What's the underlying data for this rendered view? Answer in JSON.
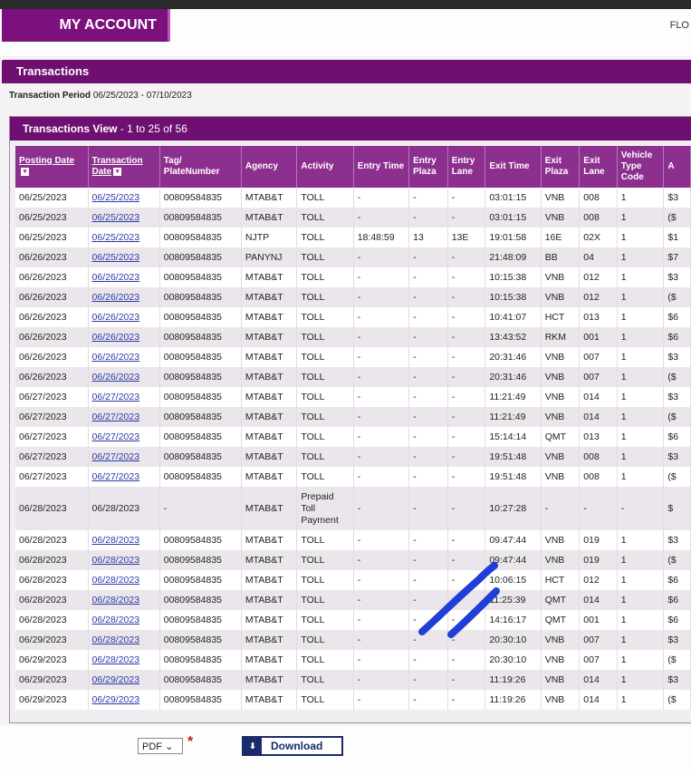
{
  "header": {
    "tab_label": "MY ACCOUNT",
    "right_text": "FLO"
  },
  "section": {
    "title": "Transactions"
  },
  "period": {
    "label": "Transaction Period",
    "value": "06/25/2023 - 07/10/2023"
  },
  "panel": {
    "title": "Transactions View",
    "range": " - 1 to 25 of 56"
  },
  "table": {
    "headers": [
      "Posting Date",
      "Transaction Date",
      "Tag/ PlateNumber",
      "Agency",
      "Activity",
      "Entry Time",
      "Entry Plaza",
      "Entry Lane",
      "Exit Time",
      "Exit Plaza",
      "Exit Lane",
      "Vehicle Type Code",
      "A"
    ],
    "rows": [
      [
        "06/25/2023",
        "06/25/2023",
        "00809584835",
        "MTAB&T",
        "TOLL",
        "-",
        "-",
        "-",
        "03:01:15",
        "VNB",
        "008",
        "1",
        "$3"
      ],
      [
        "06/25/2023",
        "06/25/2023",
        "00809584835",
        "MTAB&T",
        "TOLL",
        "-",
        "-",
        "-",
        "03:01:15",
        "VNB",
        "008",
        "1",
        "($"
      ],
      [
        "06/25/2023",
        "06/25/2023",
        "00809584835",
        "NJTP",
        "TOLL",
        "18:48:59",
        "13",
        "13E",
        "19:01:58",
        "16E",
        "02X",
        "1",
        "$1"
      ],
      [
        "06/26/2023",
        "06/25/2023",
        "00809584835",
        "PANYNJ",
        "TOLL",
        "-",
        "-",
        "-",
        "21:48:09",
        "BB",
        "04",
        "1",
        "$7"
      ],
      [
        "06/26/2023",
        "06/26/2023",
        "00809584835",
        "MTAB&T",
        "TOLL",
        "-",
        "-",
        "-",
        "10:15:38",
        "VNB",
        "012",
        "1",
        "$3"
      ],
      [
        "06/26/2023",
        "06/26/2023",
        "00809584835",
        "MTAB&T",
        "TOLL",
        "-",
        "-",
        "-",
        "10:15:38",
        "VNB",
        "012",
        "1",
        "($"
      ],
      [
        "06/26/2023",
        "06/26/2023",
        "00809584835",
        "MTAB&T",
        "TOLL",
        "-",
        "-",
        "-",
        "10:41:07",
        "HCT",
        "013",
        "1",
        "$6"
      ],
      [
        "06/26/2023",
        "06/26/2023",
        "00809584835",
        "MTAB&T",
        "TOLL",
        "-",
        "-",
        "-",
        "13:43:52",
        "RKM",
        "001",
        "1",
        "$6"
      ],
      [
        "06/26/2023",
        "06/26/2023",
        "00809584835",
        "MTAB&T",
        "TOLL",
        "-",
        "-",
        "-",
        "20:31:46",
        "VNB",
        "007",
        "1",
        "$3"
      ],
      [
        "06/26/2023",
        "06/26/2023",
        "00809584835",
        "MTAB&T",
        "TOLL",
        "-",
        "-",
        "-",
        "20:31:46",
        "VNB",
        "007",
        "1",
        "($"
      ],
      [
        "06/27/2023",
        "06/27/2023",
        "00809584835",
        "MTAB&T",
        "TOLL",
        "-",
        "-",
        "-",
        "11:21:49",
        "VNB",
        "014",
        "1",
        "$3"
      ],
      [
        "06/27/2023",
        "06/27/2023",
        "00809584835",
        "MTAB&T",
        "TOLL",
        "-",
        "-",
        "-",
        "11:21:49",
        "VNB",
        "014",
        "1",
        "($"
      ],
      [
        "06/27/2023",
        "06/27/2023",
        "00809584835",
        "MTAB&T",
        "TOLL",
        "-",
        "-",
        "-",
        "15:14:14",
        "QMT",
        "013",
        "1",
        "$6"
      ],
      [
        "06/27/2023",
        "06/27/2023",
        "00809584835",
        "MTAB&T",
        "TOLL",
        "-",
        "-",
        "-",
        "19:51:48",
        "VNB",
        "008",
        "1",
        "$3"
      ],
      [
        "06/27/2023",
        "06/27/2023",
        "00809584835",
        "MTAB&T",
        "TOLL",
        "-",
        "-",
        "-",
        "19:51:48",
        "VNB",
        "008",
        "1",
        "($"
      ],
      [
        "06/28/2023",
        "06/28/2023",
        "-",
        "MTAB&T",
        "Prepaid Toll Payment",
        "-",
        "-",
        "-",
        "10:27:28",
        "-",
        "-",
        "-",
        "$"
      ],
      [
        "06/28/2023",
        "06/28/2023",
        "00809584835",
        "MTAB&T",
        "TOLL",
        "-",
        "-",
        "-",
        "09:47:44",
        "VNB",
        "019",
        "1",
        "$3"
      ],
      [
        "06/28/2023",
        "06/28/2023",
        "00809584835",
        "MTAB&T",
        "TOLL",
        "-",
        "-",
        "-",
        "09:47:44",
        "VNB",
        "019",
        "1",
        "($"
      ],
      [
        "06/28/2023",
        "06/28/2023",
        "00809584835",
        "MTAB&T",
        "TOLL",
        "-",
        "-",
        "-",
        "10:06:15",
        "HCT",
        "012",
        "1",
        "$6"
      ],
      [
        "06/28/2023",
        "06/28/2023",
        "00809584835",
        "MTAB&T",
        "TOLL",
        "-",
        "-",
        "-",
        "11:25:39",
        "QMT",
        "014",
        "1",
        "$6"
      ],
      [
        "06/28/2023",
        "06/28/2023",
        "00809584835",
        "MTAB&T",
        "TOLL",
        "-",
        "-",
        "-",
        "14:16:17",
        "QMT",
        "001",
        "1",
        "$6"
      ],
      [
        "06/29/2023",
        "06/28/2023",
        "00809584835",
        "MTAB&T",
        "TOLL",
        "-",
        "-",
        "-",
        "20:30:10",
        "VNB",
        "007",
        "1",
        "$3"
      ],
      [
        "06/29/2023",
        "06/28/2023",
        "00809584835",
        "MTAB&T",
        "TOLL",
        "-",
        "-",
        "-",
        "20:30:10",
        "VNB",
        "007",
        "1",
        "($"
      ],
      [
        "06/29/2023",
        "06/29/2023",
        "00809584835",
        "MTAB&T",
        "TOLL",
        "-",
        "-",
        "-",
        "11:19:26",
        "VNB",
        "014",
        "1",
        "$3"
      ],
      [
        "06/29/2023",
        "06/29/2023",
        "00809584835",
        "MTAB&T",
        "TOLL",
        "-",
        "-",
        "-",
        "11:19:26",
        "VNB",
        "014",
        "1",
        "($"
      ]
    ]
  },
  "footer": {
    "format": "PDF",
    "required_mark": "*",
    "download_label": "Download"
  },
  "colors": {
    "brand": "#6e0f71",
    "header_cell": "#8c2f8e",
    "link": "#2b3aa8",
    "scribble": "#1f3fd6"
  }
}
